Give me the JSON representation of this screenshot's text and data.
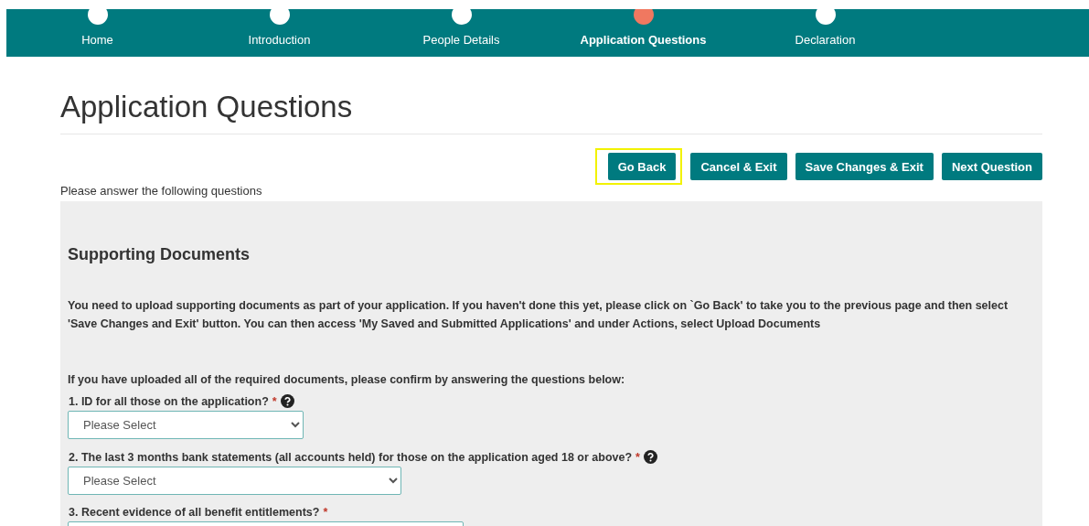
{
  "steps": [
    {
      "label": "Home",
      "selected": false
    },
    {
      "label": "Introduction",
      "selected": false
    },
    {
      "label": "People Details",
      "selected": false
    },
    {
      "label": "Application Questions",
      "selected": true
    },
    {
      "label": "Declaration",
      "selected": false
    }
  ],
  "page_title": "Application Questions",
  "buttons": [
    {
      "label": "Go Back",
      "highlighted": true
    },
    {
      "label": "Cancel & Exit",
      "highlighted": false
    },
    {
      "label": "Save Changes & Exit",
      "highlighted": false
    },
    {
      "label": "Next Question",
      "highlighted": false
    }
  ],
  "instructions": "Please answer the following questions",
  "section": {
    "heading": "Supporting Documents",
    "intro": "You need to upload supporting documents as part of your application. If you haven't done this yet, please click on `Go Back' to take you to the previous page and then select 'Save Changes and Exit' button. You can then access 'My Saved and Submitted Applications' and under Actions, select Upload Documents",
    "confirm": "If you have uploaded all of the required documents, please confirm by answering the questions below:",
    "questions": [
      {
        "label": "1. ID for all those on the application?",
        "required": "*",
        "help": true,
        "placeholder": "Please Select"
      },
      {
        "label": "2. The last 3 months bank statements (all accounts held) for those on the application aged 18 or above?",
        "required": "*",
        "help": true,
        "placeholder": "Please Select"
      },
      {
        "label": "3. Recent evidence of all benefit entitlements?",
        "required": "*",
        "help": false
      }
    ]
  }
}
